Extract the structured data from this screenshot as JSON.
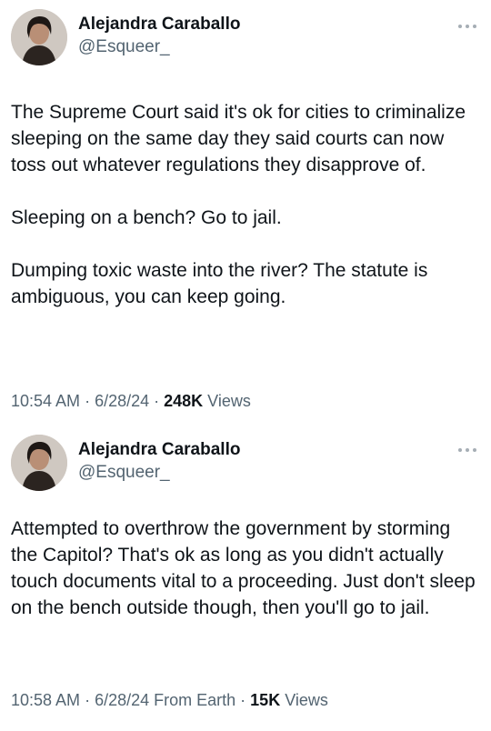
{
  "tweets": [
    {
      "author": {
        "name": "Alejandra Caraballo",
        "handle": "@Esqueer_"
      },
      "paragraphs": [
        "The Supreme Court said it's ok for cities to criminalize sleeping on the same day they said courts can now toss out whatever regulations they disapprove of.",
        "Sleeping on a bench? Go to jail.",
        "Dumping toxic waste into the river? The statute is ambiguous, you can keep going."
      ],
      "time": "10:54 AM",
      "date": "6/28/24",
      "source": "",
      "views_count": "248K",
      "views_label": "Views"
    },
    {
      "author": {
        "name": "Alejandra Caraballo",
        "handle": "@Esqueer_"
      },
      "paragraphs": [
        "Attempted to overthrow the government by storming the Capitol? That's ok as long as you didn't actually touch documents vital to a proceeding. Just don't sleep on the bench outside though, then you'll go to jail."
      ],
      "time": "10:58 AM",
      "date": "6/28/24",
      "source": "From Earth",
      "views_count": "15K",
      "views_label": "Views"
    }
  ],
  "icons": {
    "more": "more-horizontal-icon",
    "avatar": "avatar-photo"
  },
  "colors": {
    "text": "#0f1419",
    "secondary": "#536471",
    "background": "#ffffff"
  }
}
